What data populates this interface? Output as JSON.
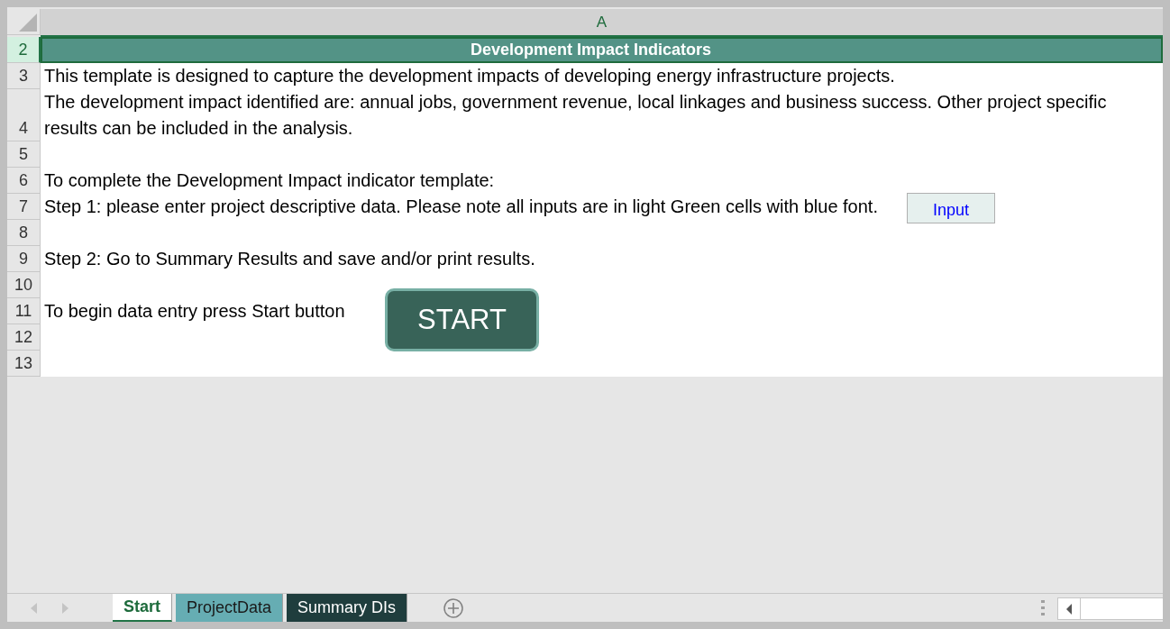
{
  "columns": [
    {
      "label": "A",
      "selected": true
    }
  ],
  "rows": [
    {
      "number": "2",
      "selected": true,
      "kind": "title",
      "text": "Development Impact Indicators"
    },
    {
      "number": "3",
      "selected": false,
      "kind": "text",
      "text": "This template is designed to capture  the development impacts of developing energy infrastructure projects."
    },
    {
      "number": "4",
      "selected": false,
      "kind": "text",
      "text": "The development impact identified are: annual jobs, government revenue, local linkages and business success. Other project specific results can be included in the analysis."
    },
    {
      "number": "5",
      "selected": false,
      "kind": "text",
      "text": ""
    },
    {
      "number": "6",
      "selected": false,
      "kind": "text",
      "text": "To complete the Development Impact indicator template:"
    },
    {
      "number": "7",
      "selected": false,
      "kind": "text",
      "text": "Step 1: please enter project descriptive data. Please note all inputs are in light Green cells with blue font."
    },
    {
      "number": "8",
      "selected": false,
      "kind": "text",
      "text": ""
    },
    {
      "number": "9",
      "selected": false,
      "kind": "text",
      "text": "Step 2: Go to Summary Results and save and/or print results."
    },
    {
      "number": "10",
      "selected": false,
      "kind": "text",
      "text": ""
    },
    {
      "number": "11",
      "selected": false,
      "kind": "text",
      "text": "To begin data entry press Start button"
    },
    {
      "number": "12",
      "selected": false,
      "kind": "text",
      "text": ""
    },
    {
      "number": "13",
      "selected": false,
      "kind": "text",
      "text": ""
    }
  ],
  "input_sample": {
    "label": "Input"
  },
  "start_button": {
    "label": "START"
  },
  "sheet_tabs": [
    {
      "label": "Start",
      "selected": true,
      "color": "#ffffff"
    },
    {
      "label": "ProjectData",
      "selected": false,
      "color": "#66adb3"
    },
    {
      "label": "Summary DIs",
      "selected": false,
      "color": "#1f3d3d"
    }
  ]
}
